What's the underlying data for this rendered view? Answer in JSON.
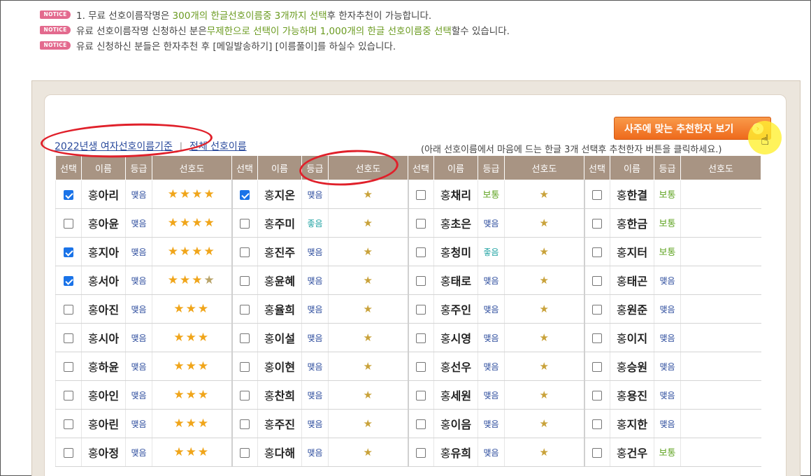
{
  "notices": {
    "badge": "NOTICE",
    "line1": {
      "a": "1. 무료 선호이름작명은 ",
      "b": "300개의 한글선호이름중 3개까지 선택",
      "c": "후 한자추천이 가능합니다."
    },
    "line2": {
      "a": "유료 선호이름작명 신청하신 분은",
      "b": "무제한으로 선택이 가능하며 1,000개의 한글 선호이름중 선택",
      "c": "할수 있습니다."
    },
    "line3": {
      "a": "유료 신청하신 분들은 한자추천 후 [메일발송하기] [이름풀이]를 하실수 있습니다."
    }
  },
  "tabs": {
    "active": "2022년생 여자선호이름기준",
    "other": "전체 선호이름",
    "separator": "|"
  },
  "recommend_button": "사주에 맞는 추천한자 보기",
  "helper_text": "(아래 선호이름에서 마음에 드는 한글 3개 선택후 추천한자 버튼을 클릭하세요.)",
  "header": {
    "select": "선택",
    "name": "이름",
    "grade": "등급",
    "pref": "선호도"
  },
  "surname": "홍",
  "rows": [
    [
      {
        "name": "아리",
        "grade": "맺음",
        "stars": "★★★★",
        "checked": true,
        "kind": "full"
      },
      {
        "name": "지온",
        "grade": "맺음",
        "stars": "★",
        "checked": true,
        "kind": "one"
      },
      {
        "name": "채리",
        "grade": "보통",
        "stars": "★",
        "checked": false,
        "kind": "one"
      },
      {
        "name": "한결",
        "grade": "보통",
        "stars": "",
        "checked": false,
        "kind": "none"
      }
    ],
    [
      {
        "name": "아윤",
        "grade": "맺음",
        "stars": "★★★★",
        "checked": false,
        "kind": "full"
      },
      {
        "name": "주미",
        "grade": "좋음",
        "stars": "★",
        "checked": false,
        "kind": "one"
      },
      {
        "name": "초은",
        "grade": "맺음",
        "stars": "★",
        "checked": false,
        "kind": "one"
      },
      {
        "name": "한금",
        "grade": "보통",
        "stars": "",
        "checked": false,
        "kind": "none"
      }
    ],
    [
      {
        "name": "지아",
        "grade": "맺음",
        "stars": "★★★★",
        "checked": true,
        "kind": "full"
      },
      {
        "name": "진주",
        "grade": "맺음",
        "stars": "★",
        "checked": false,
        "kind": "one"
      },
      {
        "name": "청미",
        "grade": "좋음",
        "stars": "★",
        "checked": false,
        "kind": "one"
      },
      {
        "name": "지터",
        "grade": "보통",
        "stars": "",
        "checked": false,
        "kind": "none"
      }
    ],
    [
      {
        "name": "서아",
        "grade": "맺음",
        "stars": "★★★★",
        "checked": true,
        "kind": "half"
      },
      {
        "name": "윤혜",
        "grade": "맺음",
        "stars": "★",
        "checked": false,
        "kind": "one"
      },
      {
        "name": "태로",
        "grade": "맺음",
        "stars": "★",
        "checked": false,
        "kind": "one"
      },
      {
        "name": "태곤",
        "grade": "맺음",
        "stars": "",
        "checked": false,
        "kind": "none"
      }
    ],
    [
      {
        "name": "아진",
        "grade": "맺음",
        "stars": "★★★",
        "checked": false,
        "kind": "full"
      },
      {
        "name": "율희",
        "grade": "맺음",
        "stars": "★",
        "checked": false,
        "kind": "one"
      },
      {
        "name": "주인",
        "grade": "맺음",
        "stars": "★",
        "checked": false,
        "kind": "one"
      },
      {
        "name": "원준",
        "grade": "맺음",
        "stars": "",
        "checked": false,
        "kind": "none"
      }
    ],
    [
      {
        "name": "시아",
        "grade": "맺음",
        "stars": "★★★",
        "checked": false,
        "kind": "full"
      },
      {
        "name": "이설",
        "grade": "맺음",
        "stars": "★",
        "checked": false,
        "kind": "one"
      },
      {
        "name": "시영",
        "grade": "맺음",
        "stars": "★",
        "checked": false,
        "kind": "one"
      },
      {
        "name": "이지",
        "grade": "맺음",
        "stars": "",
        "checked": false,
        "kind": "none"
      }
    ],
    [
      {
        "name": "하윤",
        "grade": "맺음",
        "stars": "★★★",
        "checked": false,
        "kind": "full"
      },
      {
        "name": "이현",
        "grade": "맺음",
        "stars": "★",
        "checked": false,
        "kind": "one"
      },
      {
        "name": "선우",
        "grade": "맺음",
        "stars": "★",
        "checked": false,
        "kind": "one"
      },
      {
        "name": "승원",
        "grade": "맺음",
        "stars": "",
        "checked": false,
        "kind": "none"
      }
    ],
    [
      {
        "name": "아인",
        "grade": "맺음",
        "stars": "★★★",
        "checked": false,
        "kind": "full"
      },
      {
        "name": "찬희",
        "grade": "맺음",
        "stars": "★",
        "checked": false,
        "kind": "one"
      },
      {
        "name": "세원",
        "grade": "맺음",
        "stars": "★",
        "checked": false,
        "kind": "one"
      },
      {
        "name": "용진",
        "grade": "맺음",
        "stars": "",
        "checked": false,
        "kind": "none"
      }
    ],
    [
      {
        "name": "아린",
        "grade": "맺음",
        "stars": "★★★",
        "checked": false,
        "kind": "full"
      },
      {
        "name": "주진",
        "grade": "맺음",
        "stars": "★",
        "checked": false,
        "kind": "one"
      },
      {
        "name": "이음",
        "grade": "맺음",
        "stars": "★",
        "checked": false,
        "kind": "one"
      },
      {
        "name": "지한",
        "grade": "맺음",
        "stars": "",
        "checked": false,
        "kind": "none"
      }
    ],
    [
      {
        "name": "아정",
        "grade": "맺음",
        "stars": "★★★",
        "checked": false,
        "kind": "full"
      },
      {
        "name": "다해",
        "grade": "맺음",
        "stars": "★",
        "checked": false,
        "kind": "one"
      },
      {
        "name": "유희",
        "grade": "맺음",
        "stars": "★",
        "checked": false,
        "kind": "one"
      },
      {
        "name": "건우",
        "grade": "보통",
        "stars": "",
        "checked": false,
        "kind": "none"
      }
    ]
  ]
}
